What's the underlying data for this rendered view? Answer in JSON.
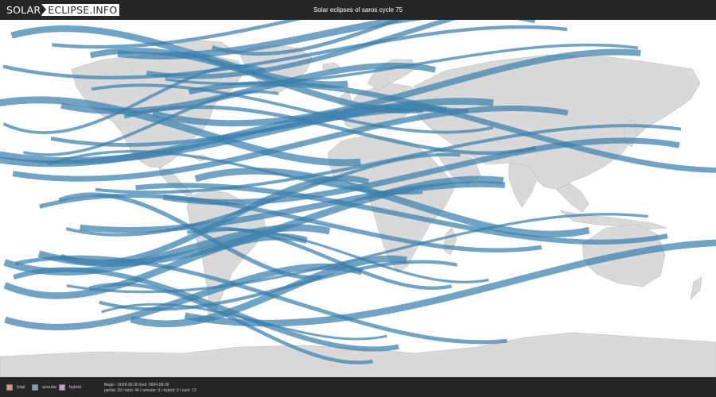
{
  "header": {
    "logo_left": "SOLAR",
    "logo_right": "ECLIPSE.INFO",
    "title": "Solar eclipses of saros cycle 75"
  },
  "map": {
    "land_color": "#d9d9d9",
    "ocean_color": "#ffffff",
    "path_color": "#3a7fad",
    "annular_path_count": 44
  },
  "legend": {
    "items": [
      {
        "label": "total",
        "color": "#e8907a"
      },
      {
        "label": "annular",
        "color": "#6fa8cf"
      },
      {
        "label": "hybrid",
        "color": "#c99ad6"
      }
    ]
  },
  "footer": {
    "dates": "Begin: -0009-06-30 End: 0694-08-26",
    "counts": "partial: 29 / total: 44 / annular: 0 / hybrid: 0 / sum: 73"
  }
}
